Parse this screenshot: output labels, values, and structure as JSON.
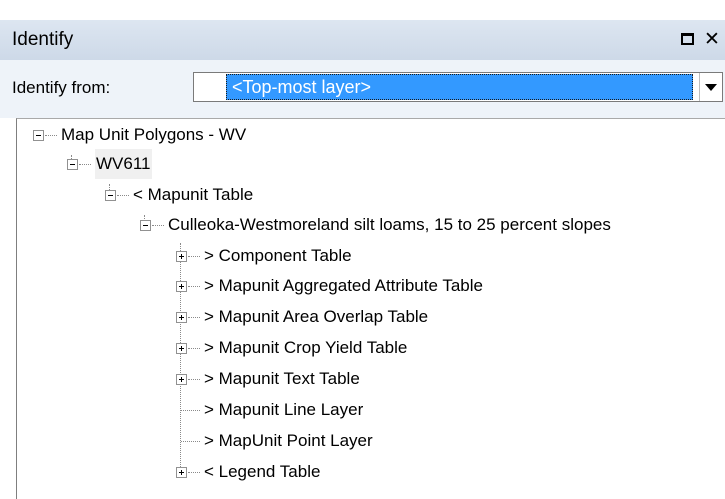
{
  "window": {
    "title": "Identify",
    "maximize_icon": "maximize-icon",
    "close_glyph": "✕"
  },
  "identify_from": {
    "label": "Identify from:",
    "selected_value": "<Top-most layer>"
  },
  "tree": {
    "root": "Map Unit Polygons - WV",
    "feature": "WV611",
    "mapunit_table": "< Mapunit Table",
    "mapunit_name": "Culleoka-Westmoreland silt loams, 15 to 25 percent slopes",
    "children": [
      "> Component Table",
      "> Mapunit Aggregated Attribute Table",
      "> Mapunit Area Overlap Table",
      "> Mapunit Crop Yield Table",
      "> Mapunit Text Table",
      "> Mapunit Line Layer",
      "> MapUnit Point Layer",
      "< Legend Table"
    ]
  },
  "colors": {
    "titlebar": "#d4dfec",
    "selection": "#3399ff",
    "from_row_bg": "#eef3f9"
  }
}
